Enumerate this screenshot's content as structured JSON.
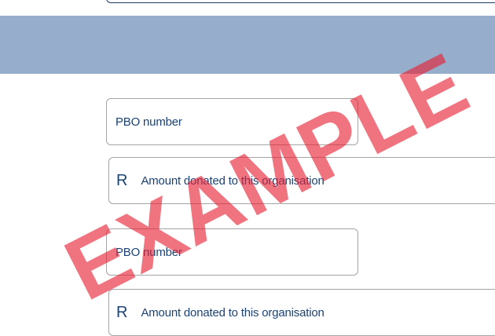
{
  "form": {
    "pbo_field_1": {
      "placeholder": "PBO number"
    },
    "amount_field_1": {
      "currency": "R",
      "placeholder": "Amount donated to this organisation"
    },
    "pbo_field_2": {
      "placeholder": "PBO number"
    },
    "amount_field_2": {
      "currency": "R",
      "placeholder": "Amount donated to this organisation"
    }
  },
  "watermark": {
    "text": "EXAMPLE",
    "color": "#e61e32"
  },
  "colors": {
    "band": "#96aecb",
    "text": "#1c4274",
    "field_border": "#a5a5a5",
    "top_field_border": "#1f3a66"
  }
}
